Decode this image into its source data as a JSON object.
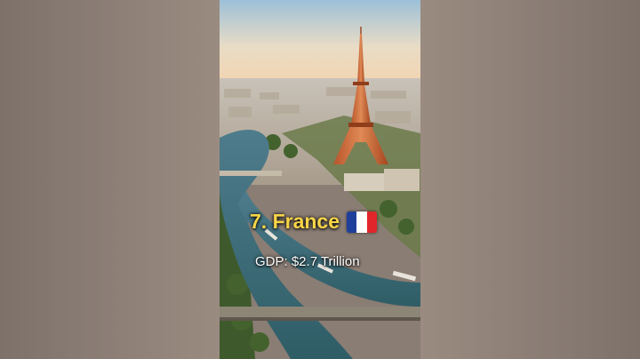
{
  "caption": {
    "title": "7. France",
    "subtitle": "GDP: $2.7 Trillion"
  },
  "flag": {
    "icon": "france-flag-icon",
    "colors": [
      "#1f3f9a",
      "#ffffff",
      "#e0262b"
    ]
  }
}
